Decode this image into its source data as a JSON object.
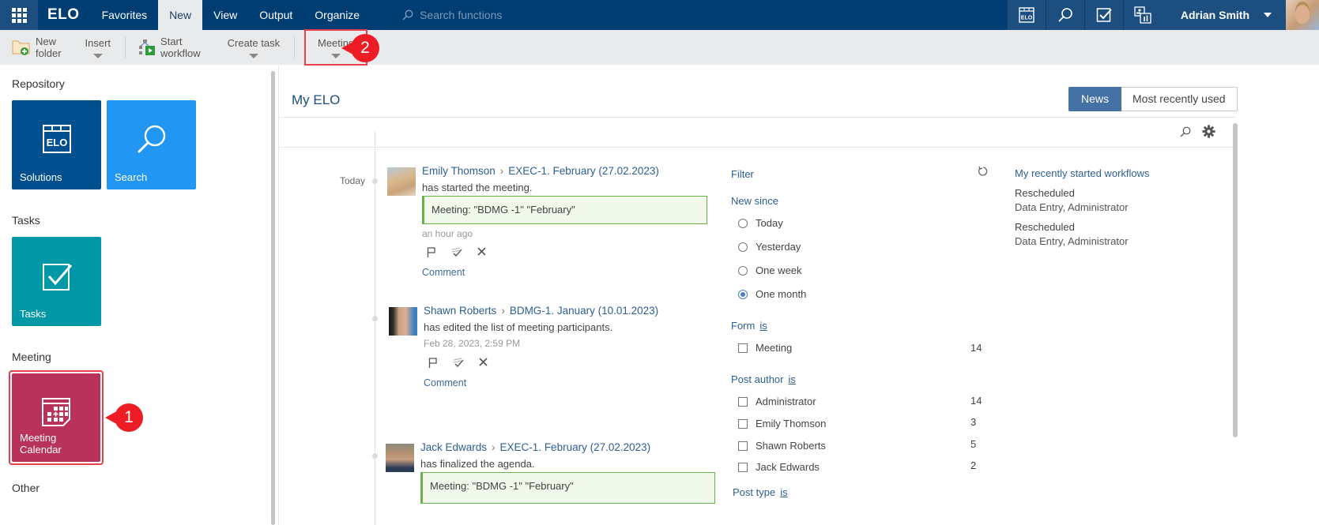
{
  "topbar": {
    "logo": "ELO",
    "tabs": [
      {
        "label": "Favorites",
        "active": false
      },
      {
        "label": "New",
        "active": true
      },
      {
        "label": "View",
        "active": false
      },
      {
        "label": "Output",
        "active": false
      },
      {
        "label": "Organize",
        "active": false
      }
    ],
    "search_placeholder": "Search functions",
    "icons": [
      "solutions-icon",
      "search-icon",
      "tasks-icon",
      "dashboard-icon"
    ],
    "user_name": "Adrian Smith"
  },
  "ribbon": {
    "new_folder": "New folder",
    "new_folder_line1": "New",
    "new_folder_line2": "folder",
    "insert": "Insert",
    "start_workflow_line1": "Start",
    "start_workflow_line2": "workflow",
    "create_task": "Create task",
    "meeting": "Meeting"
  },
  "annotations": {
    "marker1": "1",
    "marker2": "2",
    "color": "#ee1c25"
  },
  "leftpane": {
    "sections": [
      {
        "title": "Repository",
        "tiles": [
          {
            "label": "Solutions",
            "color": "#00508f"
          },
          {
            "label": "Search",
            "color": "#2196f3"
          }
        ]
      },
      {
        "title": "Tasks",
        "tiles": [
          {
            "label": "Tasks",
            "color": "#0097a7"
          }
        ]
      },
      {
        "title": "Meeting",
        "tiles": [
          {
            "label": "Meeting Calendar",
            "color": "#b9325c"
          }
        ]
      },
      {
        "title": "Other",
        "tiles": []
      }
    ]
  },
  "main": {
    "title": "My ELO",
    "segments": [
      {
        "label": "News",
        "active": true
      },
      {
        "label": "Most recently used",
        "active": false
      }
    ],
    "timeline_label": "Today",
    "posts": [
      {
        "author": "Emily Thomson",
        "target": "EXEC-1. February (27.02.2023)",
        "action": "has started the meeting.",
        "quote": "Meeting: \"BDMG -1\" \"February\"",
        "time": "an hour ago",
        "comment": "Comment"
      },
      {
        "author": "Shawn Roberts",
        "target": "BDMG-1. January (10.01.2023)",
        "action": "has edited the list of meeting participants.",
        "quote": null,
        "time": "Feb 28, 2023, 2:59 PM",
        "comment": "Comment"
      },
      {
        "author": "Jack Edwards",
        "target": "EXEC-1. February (27.02.2023)",
        "action": "has finalized the agenda.",
        "quote": "Meeting: \"BDMG -1\" \"February\"",
        "time": null,
        "comment": null
      }
    ],
    "filter": {
      "title": "Filter",
      "new_since": {
        "label": "New since",
        "options": [
          "Today",
          "Yesterday",
          "One week",
          "One month"
        ],
        "selected": "One month"
      },
      "form": {
        "label": "Form",
        "op": "is",
        "options": [
          {
            "label": "Meeting",
            "count": "14"
          }
        ]
      },
      "post_author": {
        "label": "Post author",
        "op": "is",
        "options": [
          {
            "label": "Administrator",
            "count": "14"
          },
          {
            "label": "Emily Thomson",
            "count": "3"
          },
          {
            "label": "Shawn Roberts",
            "count": "5"
          },
          {
            "label": "Jack Edwards",
            "count": "2"
          }
        ]
      },
      "post_type": {
        "label": "Post type",
        "op": "is"
      }
    },
    "workflows": {
      "title": "My recently started workflows",
      "items": [
        {
          "name": "Rescheduled",
          "sub": "Data Entry, Administrator"
        },
        {
          "name": "Rescheduled",
          "sub": "Data Entry, Administrator"
        }
      ]
    }
  }
}
